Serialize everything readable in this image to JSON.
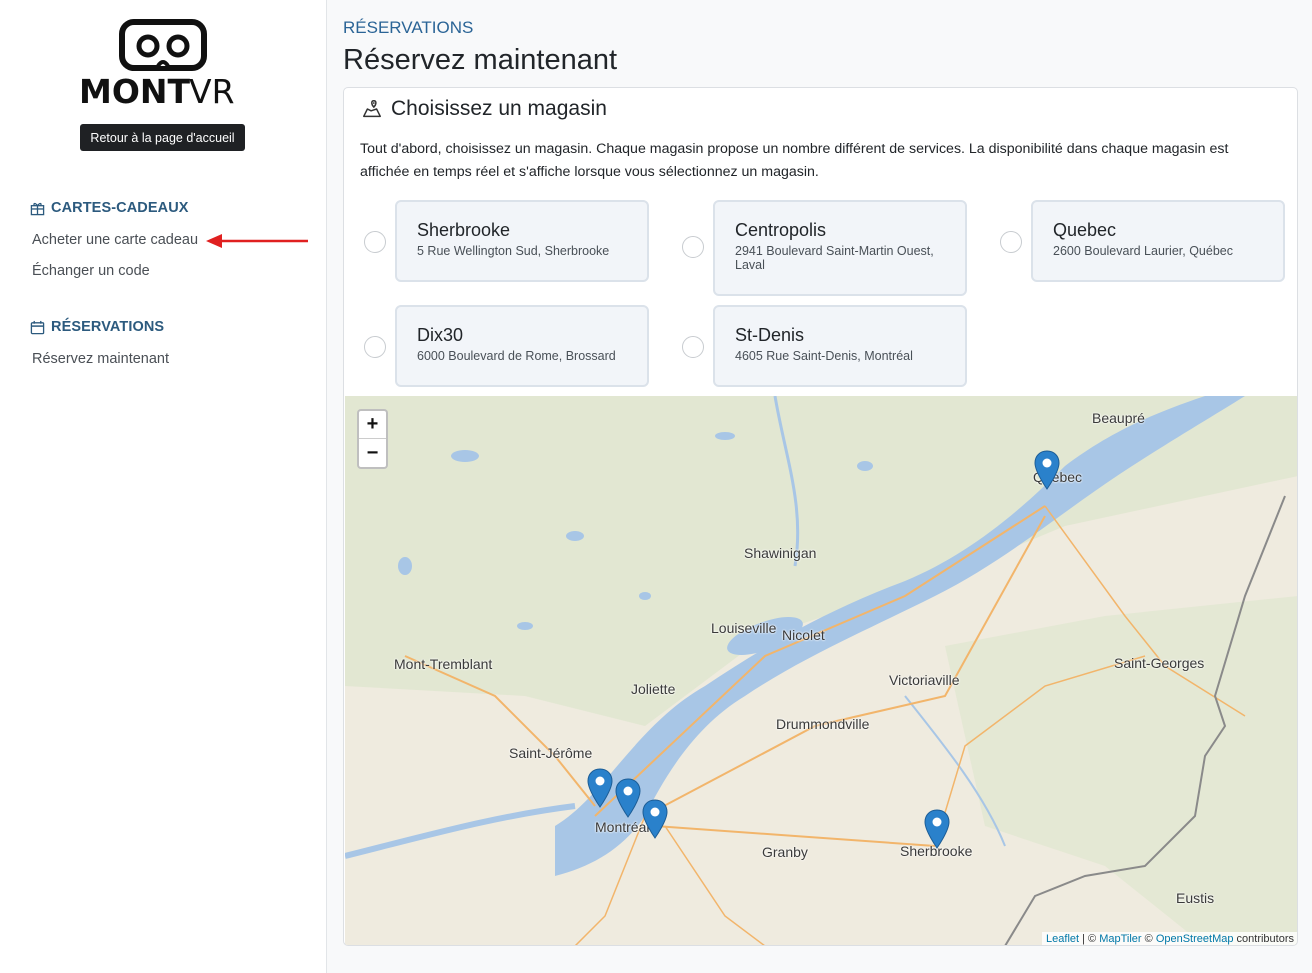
{
  "sidebar": {
    "logo_text_a": "MONT",
    "logo_text_b": "VR",
    "home_button": "Retour à la page d'accueil",
    "gift_section": "CARTES-CADEAUX",
    "gift_links": [
      "Acheter une carte cadeau",
      "Échanger un code"
    ],
    "reservations_section": "RÉSERVATIONS",
    "reservation_links": [
      "Réservez maintenant"
    ]
  },
  "main": {
    "breadcrumb": "RÉSERVATIONS",
    "title": "Réservez maintenant",
    "card_title": "Choisissez un magasin",
    "intro": "Tout d'abord, choisissez un magasin. Chaque magasin propose un nombre différent de services. La disponibilité dans chaque magasin est affichée en temps réel et s'affiche lorsque vous sélectionnez un magasin.",
    "stores": [
      {
        "name": "Sherbrooke",
        "address": "5 Rue Wellington Sud, Sherbrooke"
      },
      {
        "name": "Centropolis",
        "address": "2941 Boulevard Saint-Martin Ouest, Laval"
      },
      {
        "name": "Quebec",
        "address": "2600 Boulevard Laurier, Québec"
      },
      {
        "name": "Dix30",
        "address": "6000 Boulevard de Rome, Brossard"
      },
      {
        "name": "St-Denis",
        "address": "4605 Rue Saint-Denis, Montréal"
      }
    ]
  },
  "map": {
    "zoom_in": "+",
    "zoom_out": "−",
    "cities": {
      "beaupre": "Beaupré",
      "quebec": "Québec",
      "shawinigan": "Shawinigan",
      "louiseville": "Louiseville",
      "nicolet": "Nicolet",
      "mont_tremblant": "Mont-Tremblant",
      "joliette": "Joliette",
      "victoriaville": "Victoriaville",
      "saint_georges": "Saint-Georges",
      "drummondville": "Drummondville",
      "saint_jerome": "Saint-Jérôme",
      "montreal": "Montréal",
      "granby": "Granby",
      "sherbrooke": "Sherbrooke",
      "eustis": "Eustis"
    },
    "attribution": {
      "leaflet": "Leaflet",
      "sep": " | © ",
      "maptiler": "MapTiler",
      "sep2": " © ",
      "osm": "OpenStreetMap",
      "contributors": " contributors"
    },
    "marker_color": "#2a81cb"
  }
}
